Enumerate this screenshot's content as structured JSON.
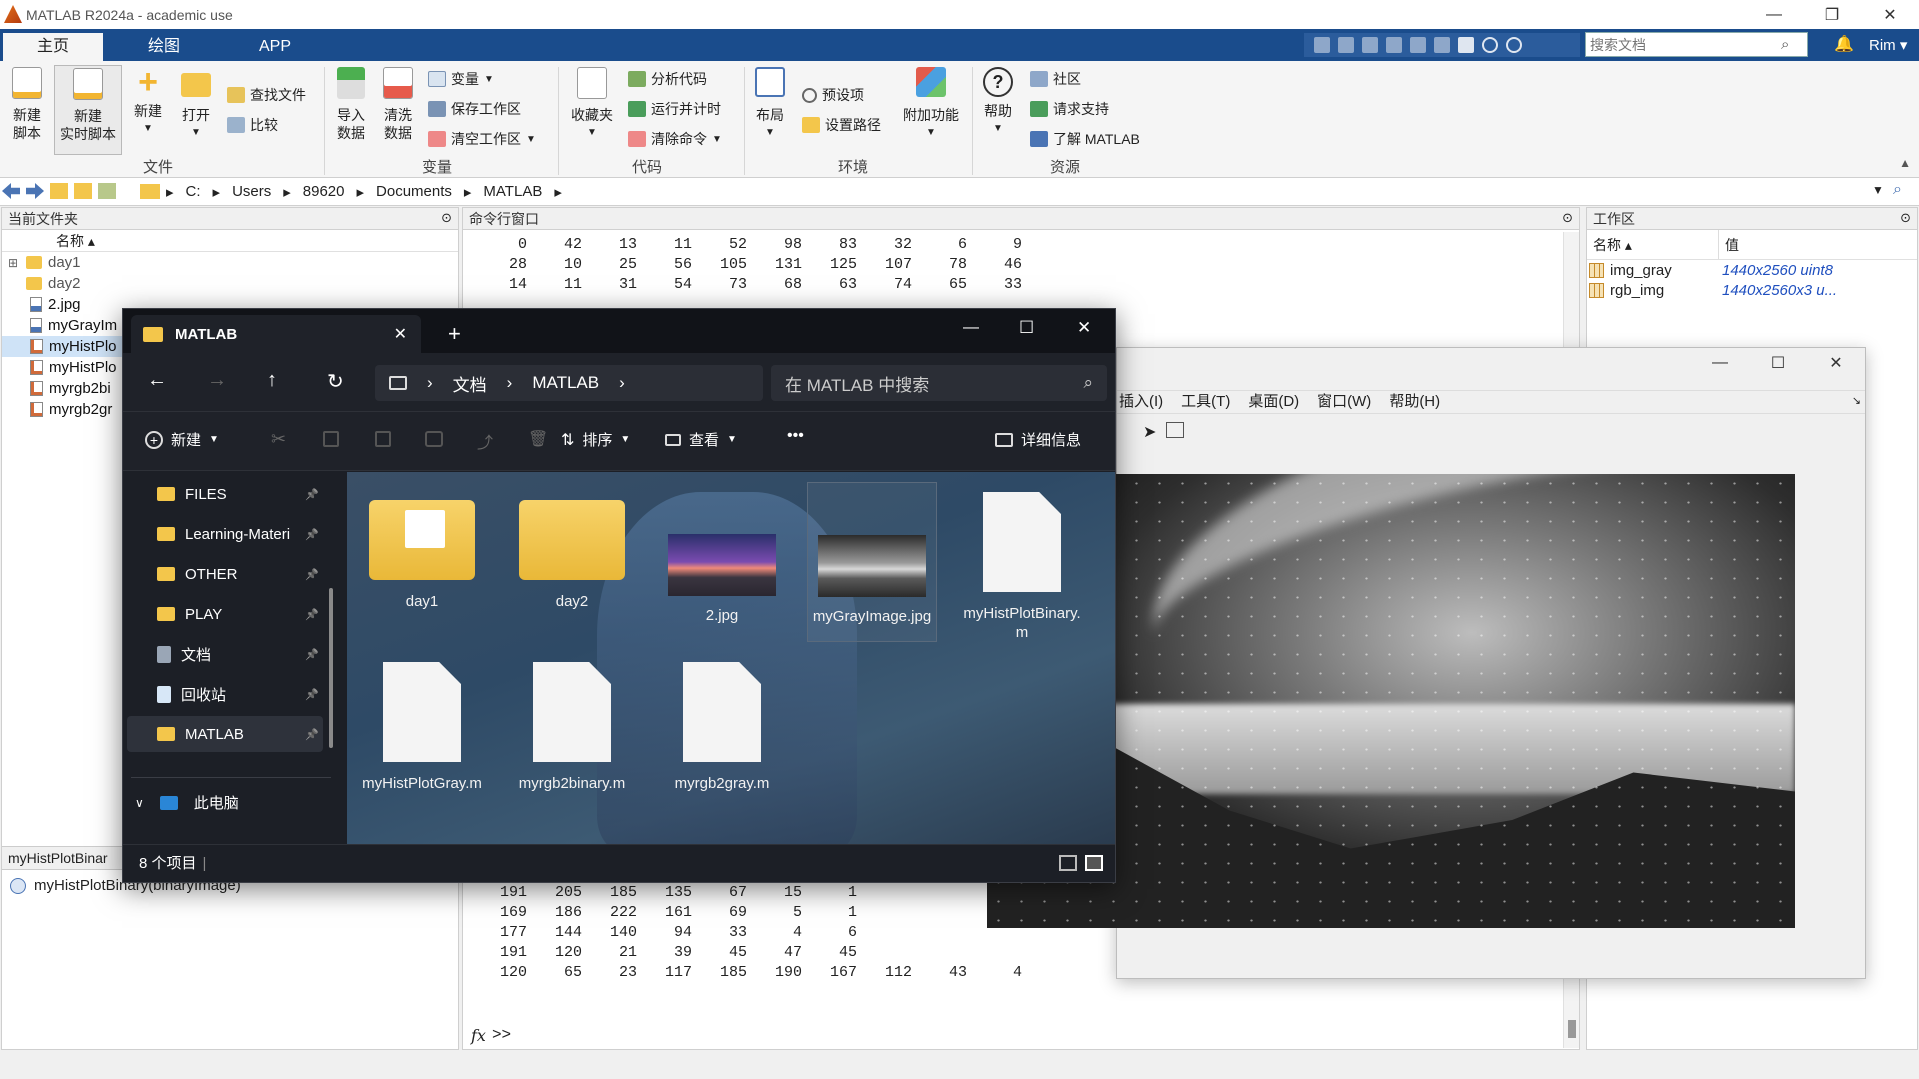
{
  "app": {
    "title": "MATLAB R2024a - academic use",
    "window_controls": {
      "minimize": "—",
      "maximize": "❐",
      "close": "✕"
    }
  },
  "tabs": [
    {
      "label": "主页",
      "active": true
    },
    {
      "label": "绘图",
      "active": false
    },
    {
      "label": "APP",
      "active": false
    }
  ],
  "search": {
    "placeholder": "搜索文档"
  },
  "user": {
    "name": "Rim ▾"
  },
  "ribbon": {
    "file_group": {
      "label": "文件",
      "new_script": "新建\n脚本",
      "new_live_script": "新建\n实时脚本",
      "new": "新建",
      "open": "打开",
      "find_files": "查找文件",
      "compare": "比较"
    },
    "variable_group": {
      "label": "变量",
      "import": "导入\n数据",
      "clean": "清洗\n数据",
      "variable": "变量",
      "save_ws": "保存工作区",
      "clear_ws": "清空工作区"
    },
    "code_group": {
      "label": "代码",
      "favorites": "收藏夹",
      "analyze": "分析代码",
      "run_time": "运行并计时",
      "clear_cmd": "清除命令"
    },
    "env_group": {
      "label": "环境",
      "layout": "布局",
      "prefs": "预设项",
      "set_path": "设置路径",
      "addons": "附加功能"
    },
    "res_group": {
      "label": "资源",
      "help": "帮助",
      "community": "社区",
      "support": "请求支持",
      "learn": "了解 MATLAB"
    }
  },
  "address": {
    "segments": [
      "C:",
      "Users",
      "89620",
      "Documents",
      "MATLAB"
    ]
  },
  "current_folder": {
    "title": "当前文件夹",
    "col_name": "名称 ▴",
    "items": [
      {
        "name": "day1",
        "type": "folder"
      },
      {
        "name": "day2",
        "type": "folder"
      },
      {
        "name": "2.jpg",
        "type": "image"
      },
      {
        "name": "myGrayIm",
        "type": "image"
      },
      {
        "name": "myHistPlo",
        "type": "m"
      },
      {
        "name": "myHistPlo",
        "type": "m"
      },
      {
        "name": "myrgb2bi",
        "type": "m"
      },
      {
        "name": "myrgb2gr",
        "type": "m"
      }
    ],
    "detail_title": "myHistPlotBinar",
    "detail_item": "myHistPlotBinary(binaryImage)"
  },
  "command_window": {
    "title": "命令行窗口",
    "rows_top": [
      [
        "0",
        "42",
        "13",
        "11",
        "52",
        "98",
        "83",
        "32",
        "6",
        "9"
      ],
      [
        "28",
        "10",
        "25",
        "56",
        "105",
        "131",
        "125",
        "107",
        "78",
        "46"
      ],
      [
        "14",
        "11",
        "31",
        "54",
        "73",
        "68",
        "63",
        "74",
        "65",
        "33"
      ]
    ],
    "rows_bottom": [
      [
        "191",
        "205",
        "185",
        "135",
        "67",
        "15",
        "1"
      ],
      [
        "169",
        "186",
        "222",
        "161",
        "69",
        "5",
        "1"
      ],
      [
        "177",
        "144",
        "140",
        "94",
        "33",
        "4",
        "6"
      ],
      [
        "191",
        "120",
        "21",
        "39",
        "45",
        "47",
        "45"
      ],
      [
        "120",
        "65",
        "23",
        "117",
        "185",
        "190",
        "167",
        "112",
        "43",
        "4"
      ]
    ],
    "prompt": ">>",
    "fx": "fx"
  },
  "workspace": {
    "title": "工作区",
    "col_name": "名称 ▴",
    "col_value": "值",
    "vars": [
      {
        "name": "img_gray",
        "value": "1440x2560 uint8"
      },
      {
        "name": "rgb_img",
        "value": "1440x2560x3 u..."
      }
    ]
  },
  "explorer": {
    "tab_title": "MATLAB",
    "breadcrumb": [
      "文档",
      "MATLAB"
    ],
    "search_placeholder": "在 MATLAB 中搜索",
    "toolbar": {
      "new": "新建",
      "sort": "排序",
      "view": "查看",
      "more": "•••",
      "details": "详细信息"
    },
    "sidebar": [
      {
        "label": "FILES",
        "kind": "folder"
      },
      {
        "label": "Learning-Materi",
        "kind": "folder"
      },
      {
        "label": "OTHER",
        "kind": "folder"
      },
      {
        "label": "PLAY",
        "kind": "folder"
      },
      {
        "label": "文档",
        "kind": "doc"
      },
      {
        "label": "回收站",
        "kind": "bin"
      },
      {
        "label": "MATLAB",
        "kind": "folder"
      }
    ],
    "this_pc": "此电脑",
    "files": [
      {
        "name": "day1",
        "kind": "folder-doc"
      },
      {
        "name": "day2",
        "kind": "folder"
      },
      {
        "name": "2.jpg",
        "kind": "color-image"
      },
      {
        "name": "myGrayImage.jpg",
        "kind": "gray-image"
      },
      {
        "name": "myHistPlotBinary.m",
        "kind": "file"
      },
      {
        "name": "myHistPlotGray.m",
        "kind": "file"
      },
      {
        "name": "myrgb2binary.m",
        "kind": "file"
      },
      {
        "name": "myrgb2gray.m",
        "kind": "file"
      }
    ],
    "status": "8 个项目"
  },
  "figure": {
    "menu": [
      "插入(I)",
      "工具(T)",
      "桌面(D)",
      "窗口(W)",
      "帮助(H)"
    ],
    "controls": {
      "minimize": "—",
      "maximize": "☐",
      "close": "✕"
    }
  },
  "colors": {
    "ribbon_tab_bg": "#1a4c8c",
    "explorer_bg": "#1c1f26",
    "folder_yellow": "#f3c64b",
    "link_blue": "#1f4fbf"
  }
}
